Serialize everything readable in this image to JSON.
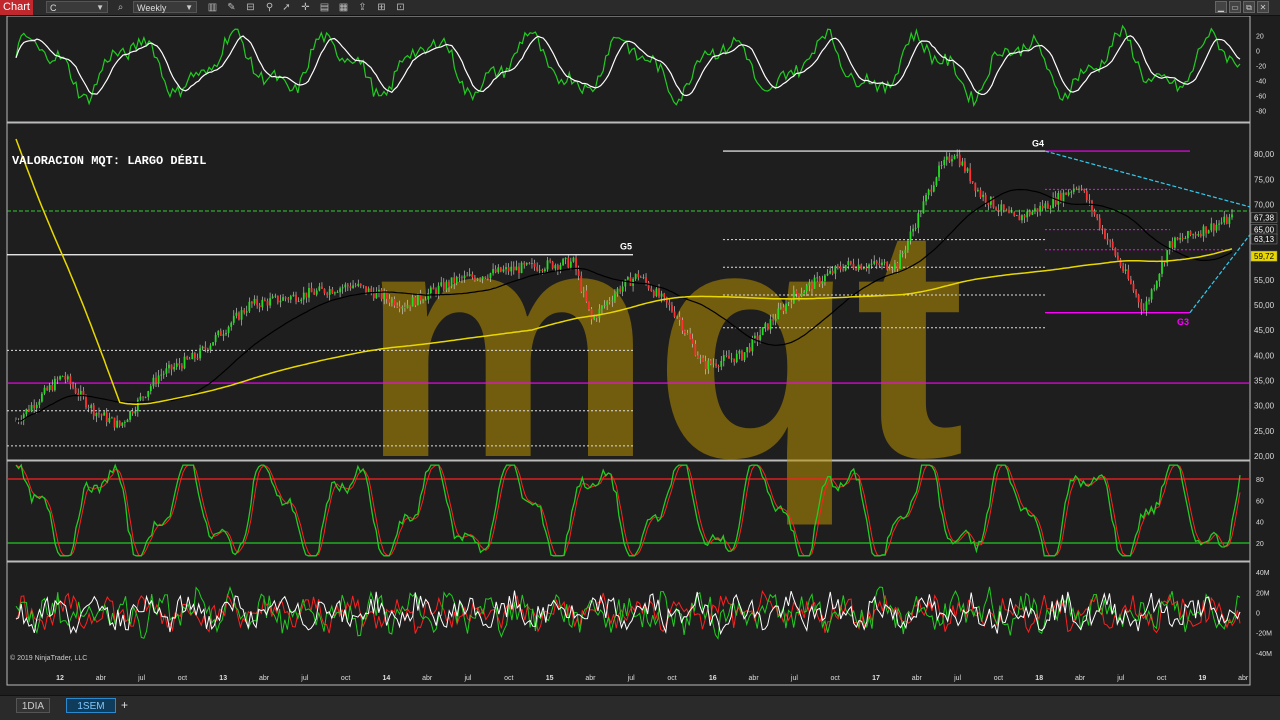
{
  "toolbar": {
    "chart_tab": "Chart",
    "instrument": "C",
    "interval": "Weekly",
    "icons": [
      "search-icon",
      "bar-style-icon",
      "draw-tool-icon",
      "properties-icon",
      "pointer-icon",
      "crosshair-icon",
      "templates-icon",
      "data-box-icon",
      "strategy-icon",
      "share-icon"
    ],
    "window_icons": [
      "minimize-icon",
      "restore-icon",
      "maximize-icon",
      "close-icon"
    ]
  },
  "chart_data": [
    {
      "type": "line",
      "panel": "oscillator-top",
      "y_ticks": [
        "20",
        "0",
        "-20",
        "-40",
        "-60",
        "-80"
      ],
      "ylim": [
        -90,
        35
      ],
      "series": [
        {
          "color": "#22cc22"
        },
        {
          "color": "#ffffff"
        }
      ]
    },
    {
      "type": "candlestick",
      "panel": "price",
      "title": "VALORACION MQT: LARGO DÉBIL",
      "ylim": [
        20,
        83
      ],
      "y_ticks": [
        "80,00",
        "75,00",
        "70,00",
        "65,00",
        "60,00",
        "55,00",
        "50,00",
        "45,00",
        "40,00",
        "35,00",
        "30,00",
        "25,00",
        "20,00"
      ],
      "price_labels": [
        "67,38",
        "65,00",
        "63,13",
        "59,72"
      ],
      "annotations": [
        "G5",
        "G4",
        "G3"
      ],
      "watermark": "mqt",
      "x_ticks": [
        "12",
        "abr",
        "jul",
        "oct",
        "13",
        "abr",
        "jul",
        "oct",
        "14",
        "abr",
        "jul",
        "oct",
        "15",
        "abr",
        "jul",
        "oct",
        "16",
        "abr",
        "jul",
        "oct",
        "17",
        "abr",
        "jul",
        "oct",
        "18",
        "abr",
        "jul",
        "oct",
        "19",
        "abr"
      ],
      "levels": {
        "resistance_g5": 60.0,
        "magenta_support": 34.5,
        "green_dashed": 68.7,
        "g4_high": 80.6,
        "g3_low": 48.5
      },
      "series": [
        {
          "color": "#e8d800"
        },
        {
          "color": "#000000"
        }
      ]
    },
    {
      "type": "line",
      "panel": "stochastic",
      "y_ticks": [
        "80",
        "60",
        "40",
        "20"
      ],
      "ylim": [
        5,
        95
      ],
      "overbought": 80,
      "oversold": 20,
      "series": [
        {
          "color": "#22cc22"
        },
        {
          "color": "#ff2020"
        }
      ]
    },
    {
      "type": "line",
      "panel": "volume-oscillator",
      "y_ticks": [
        "40M",
        "20M",
        "0",
        "-20M",
        "-40M"
      ],
      "ylim": [
        -45,
        48
      ],
      "series": [
        {
          "color": "#22cc22"
        },
        {
          "color": "#ff2020"
        },
        {
          "color": "#ffffff"
        }
      ]
    }
  ],
  "copyright": "© 2019 NinjaTrader, LLC",
  "bottom_tabs": [
    "1DIA",
    "1SEM"
  ],
  "add_tab": "+",
  "colors": {
    "up": "#22dd22",
    "down": "#ff3030",
    "accent": "#c0282d",
    "magenta": "#ff00ff",
    "cyan": "#33ccee"
  }
}
